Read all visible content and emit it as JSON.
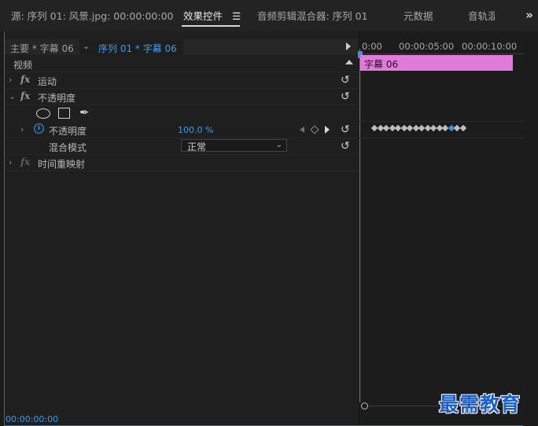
{
  "tabs": [
    {
      "label": "源: 序列 01: 风景.jpg: 00:00:00:00",
      "active": false
    },
    {
      "label": "效果控件",
      "active": true,
      "menu_icon": "☰"
    },
    {
      "label": "音频剪辑混合器: 序列 01",
      "active": false
    },
    {
      "label": "元数据",
      "active": false
    },
    {
      "label": "音轨混",
      "active": false
    }
  ],
  "overflow_icon": "»",
  "clip_selector": {
    "master_label": "主要 * 字幕 06",
    "sequence_label": "序列 01 * 字幕 06"
  },
  "sections": {
    "video": "视频",
    "motion": "运动",
    "opacity_group": "不透明度",
    "opacity_property": "不透明度",
    "opacity_value": "100.0 %",
    "blend_mode_label": "混合模式",
    "blend_mode_value": "正常",
    "time_remap": "时间重映射"
  },
  "icons": {
    "fx": "fx",
    "reset": "↺",
    "pen": "✒",
    "chevron_right": "›",
    "chevron_down": "⌄"
  },
  "timeline": {
    "ruler_labels": [
      "0:00",
      "00:00:05:00",
      "00:00:10:00"
    ],
    "clip_name": "字幕 06",
    "keyframe_count": 16,
    "selected_keyframe_index": 13
  },
  "current_time": "00:00:00:00",
  "watermark": "最需教育",
  "colors": {
    "accent_blue": "#3d9be9",
    "clip_pink": "#e27ad9",
    "panel_bg": "#1f1f1f"
  }
}
